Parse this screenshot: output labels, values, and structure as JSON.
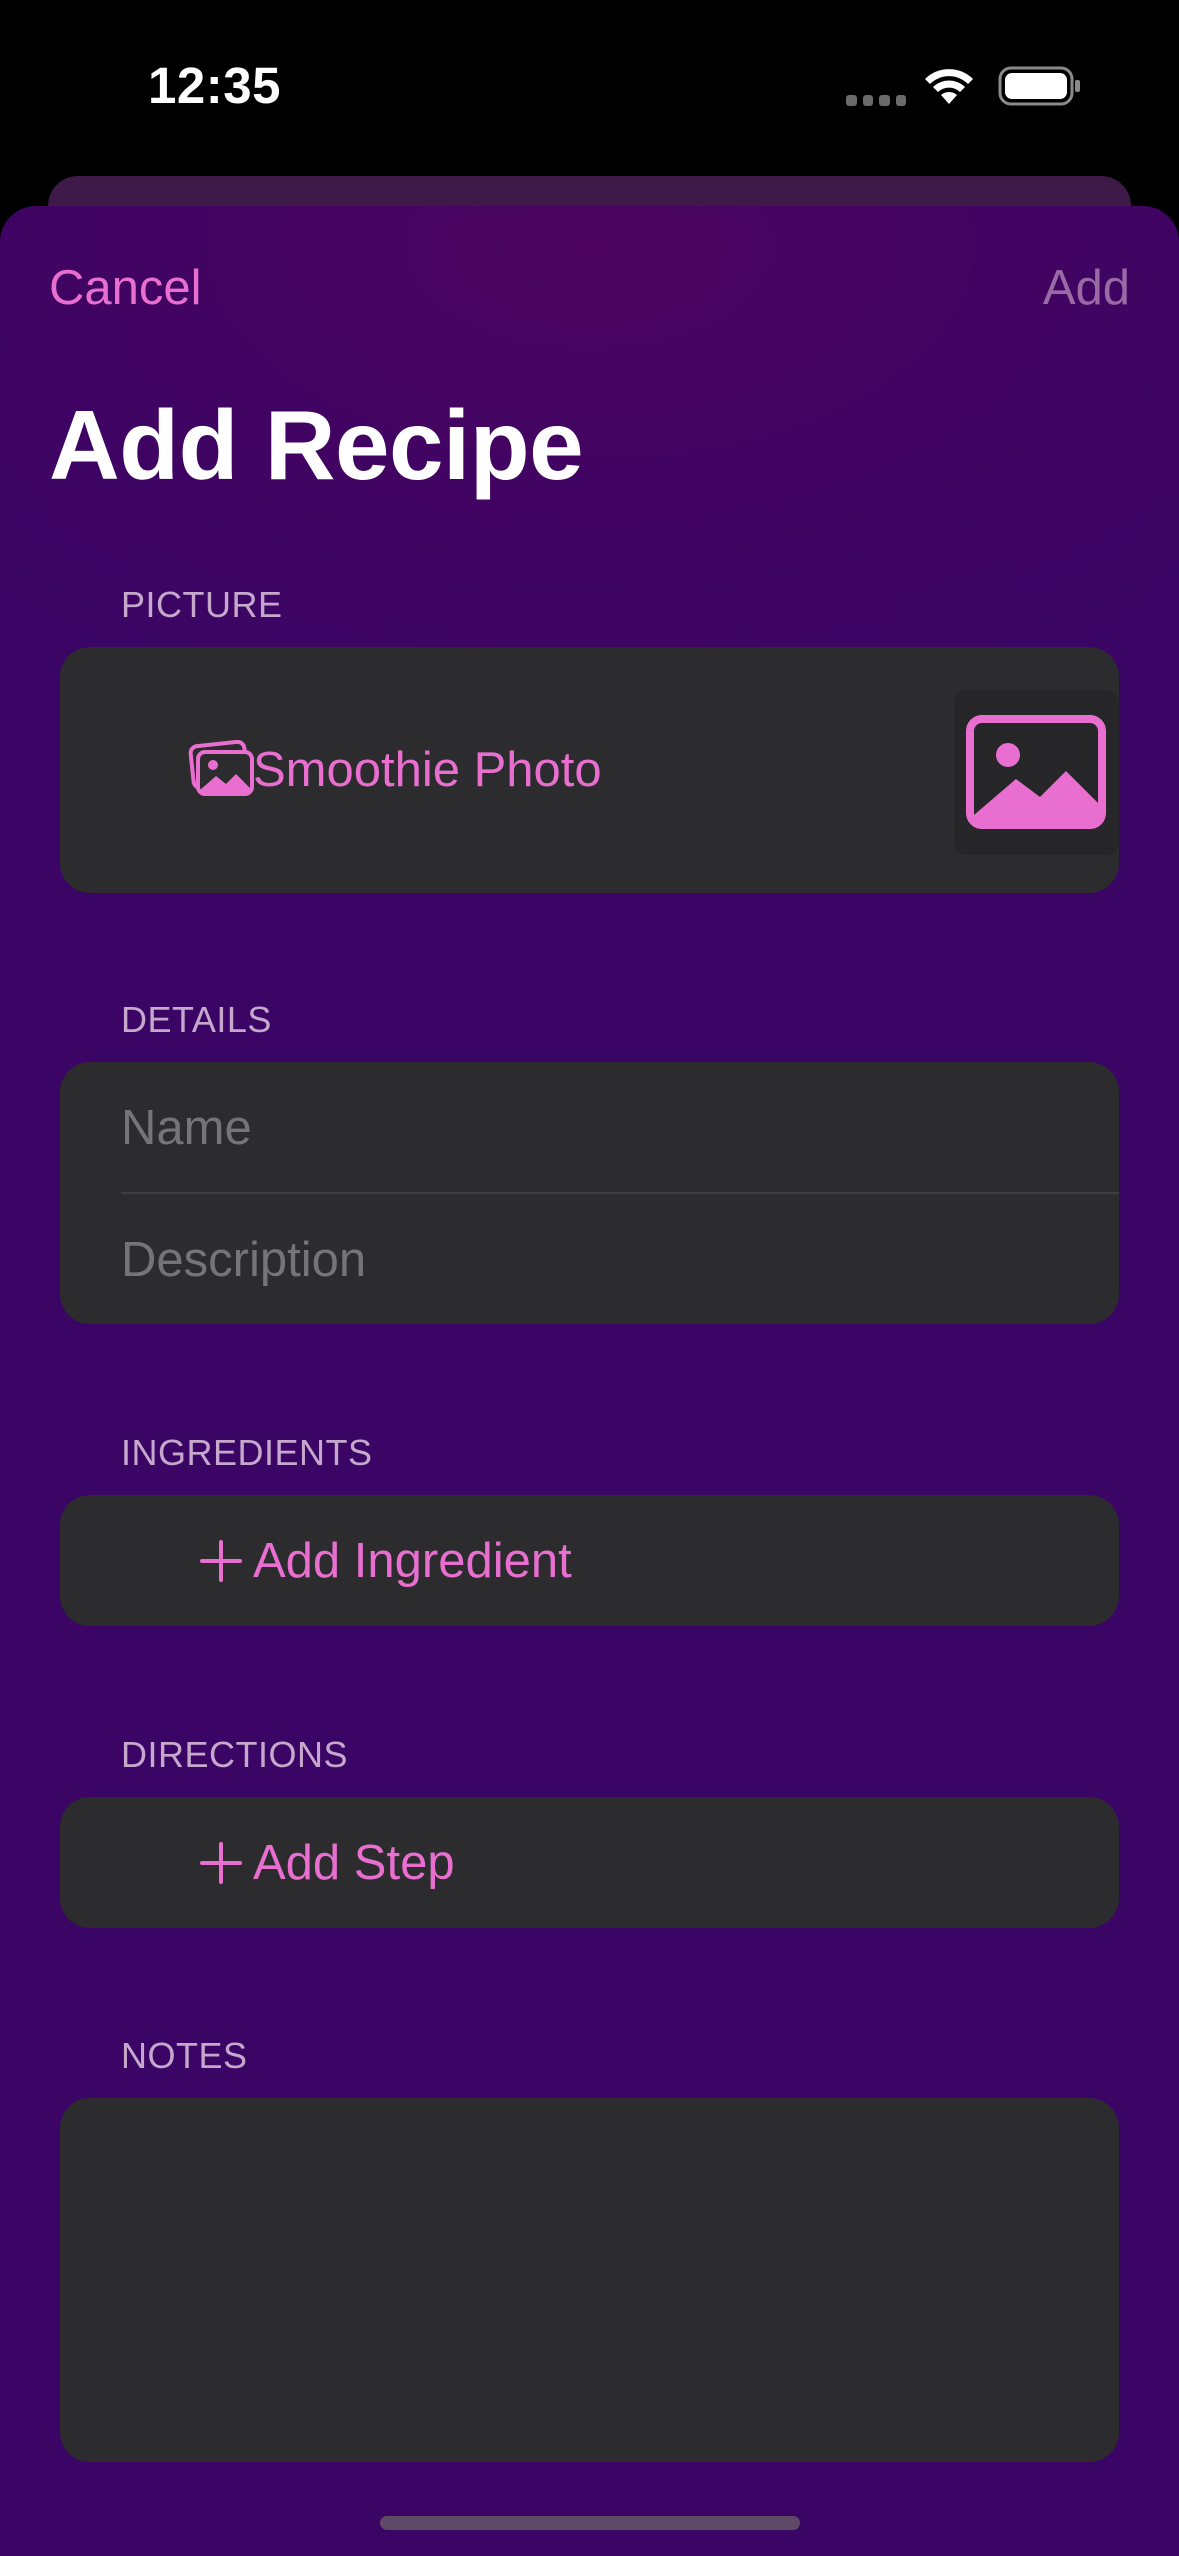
{
  "status_bar": {
    "time": "12:35"
  },
  "nav": {
    "cancel_label": "Cancel",
    "add_label": "Add",
    "title": "Add Recipe"
  },
  "sections": {
    "picture": {
      "header": "PICTURE",
      "photo_label": "Smoothie Photo",
      "icon": "photos-icon",
      "thumbnail_icon": "photo-placeholder-icon"
    },
    "details": {
      "header": "DETAILS",
      "name_placeholder": "Name",
      "description_placeholder": "Description"
    },
    "ingredients": {
      "header": "INGREDIENTS",
      "add_label": "Add Ingredient",
      "icon": "plus-icon"
    },
    "directions": {
      "header": "DIRECTIONS",
      "add_label": "Add Step",
      "icon": "plus-icon"
    },
    "notes": {
      "header": "NOTES"
    }
  },
  "colors": {
    "accent": "#e86fd0",
    "background": "#3a0565",
    "card": "#2c2c2e",
    "disabled": "#9a6aa6"
  }
}
